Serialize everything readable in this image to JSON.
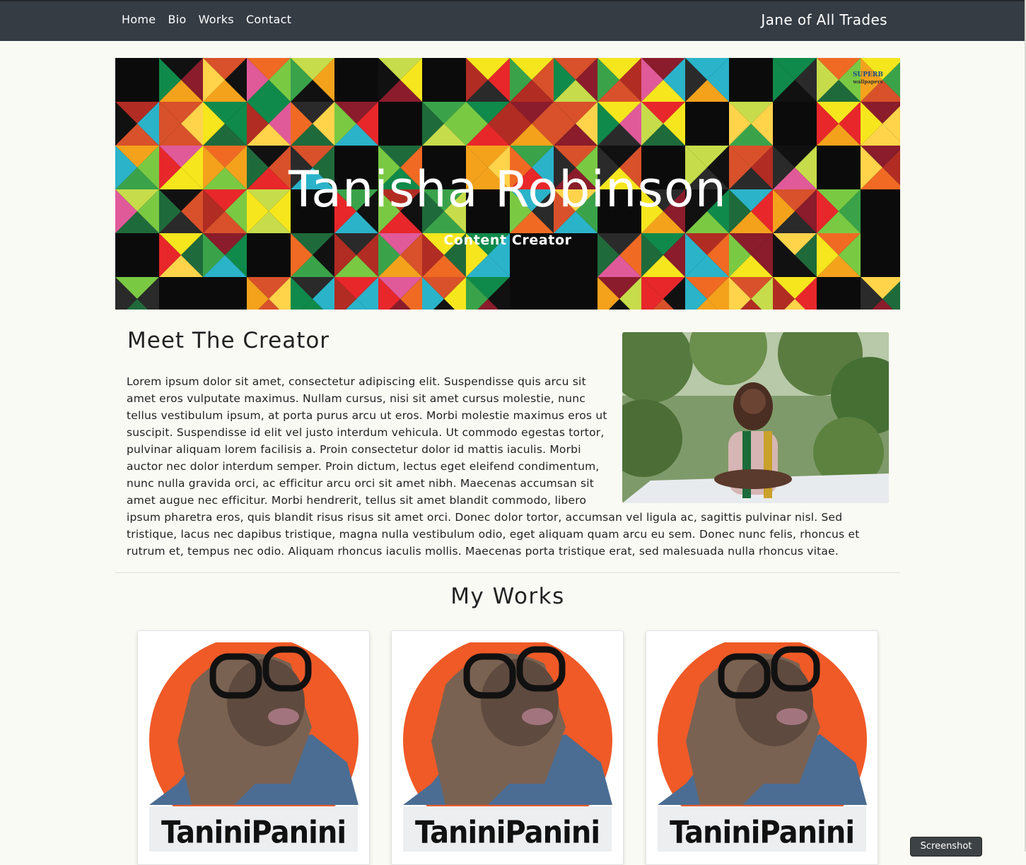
{
  "nav": {
    "links": [
      "Home",
      "Bio",
      "Works",
      "Contact"
    ],
    "brand": "Jane of All Trades"
  },
  "hero": {
    "title": "Tanisha Robinson",
    "subtitle": "Content Creator",
    "watermark_line1": "SUPERB",
    "watermark_line2": "wallpapers"
  },
  "bio": {
    "title": "Meet The Creator",
    "text": "Lorem ipsum dolor sit amet, consectetur adipiscing elit. Suspendisse quis arcu sit amet eros vulputate maximus. Nullam cursus, nisi sit amet cursus molestie, nunc tellus vestibulum ipsum, at porta purus arcu ut eros. Morbi molestie maximus eros ut suscipit. Suspendisse id elit vel justo interdum vehicula. Ut commodo egestas tortor, pulvinar aliquam lorem facilisis a. Proin consectetur dolor id mattis iaculis. Morbi auctor nec dolor interdum semper. Proin dictum, lectus eget eleifend condimentum, nunc nulla gravida orci, ac efficitur arcu orci sit amet nibh. Maecenas accumsan sit amet augue nec efficitur. Morbi hendrerit, tellus sit amet blandit commodo, libero ipsum pharetra eros, quis blandit risus risus sit amet orci. Donec dolor tortor, accumsan vel ligula ac, sagittis pulvinar nisl. Sed tristique, lacus nec dapibus tristique, magna nulla vestibulum odio, eget aliquam quam arcu eu sem. Donec nunc felis, rhoncus et rutrum et, tempus nec odio. Aliquam rhoncus iaculis mollis. Maecenas porta tristique erat, sed malesuada nulla rhoncus vitae."
  },
  "works": {
    "title": "My Works",
    "cards": [
      {
        "logo_text": "TaniniPanini"
      },
      {
        "logo_text": "TaniniPanini"
      },
      {
        "logo_text": "TaniniPanini"
      }
    ]
  },
  "overlay": {
    "screenshot_label": "Screenshot"
  },
  "colors": {
    "navbar": "#353c44",
    "page_bg": "#fafaf4",
    "avatar_circle": "#ef5a27",
    "avatar_shirt": "#4b6d93",
    "avatar_skin": "#6e5547"
  }
}
